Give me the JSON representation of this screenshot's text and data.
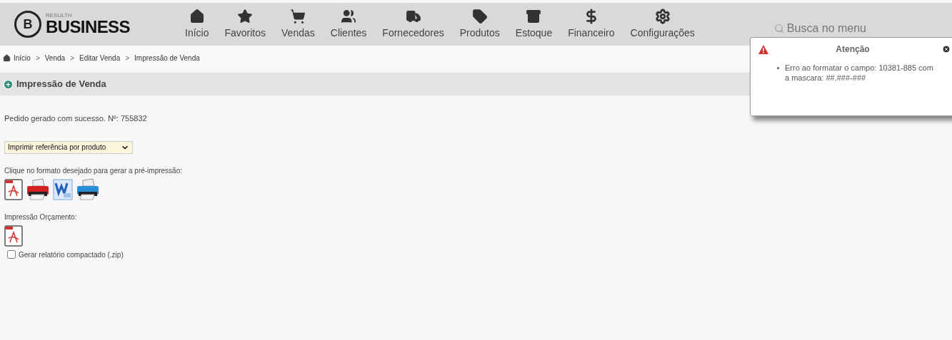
{
  "logo": {
    "mark": "B",
    "small": "RESULTH",
    "name": "BUSINESS"
  },
  "nav": [
    {
      "label": "Início",
      "kind": "home"
    },
    {
      "label": "Favoritos",
      "kind": "star"
    },
    {
      "label": "Vendas",
      "kind": "cart"
    },
    {
      "label": "Clientes",
      "kind": "users"
    },
    {
      "label": "Fornecedores",
      "kind": "truck"
    },
    {
      "label": "Produtos",
      "kind": "tag"
    },
    {
      "label": "Estoque",
      "kind": "box"
    },
    {
      "label": "Financeiro",
      "kind": "dollar"
    },
    {
      "label": "Configurações",
      "kind": "gear"
    }
  ],
  "search": {
    "placeholder": "Busca no menu"
  },
  "breadcrumb": [
    "Início",
    "Venda",
    "Editar Venda",
    "Impressão de Venda"
  ],
  "breadcrumb_separator": ">",
  "page_title": "Impressão de Venda",
  "message": "Pedido gerado com sucesso. Nº: 755832",
  "print_select": {
    "value": "Imprimir referência por produto"
  },
  "format_label": "Clique no formato desejado para gerar a pré-impressão:",
  "formats": [
    {
      "kind": "pdf"
    },
    {
      "kind": "printer-red"
    },
    {
      "kind": "word"
    },
    {
      "kind": "printer-blue"
    }
  ],
  "budget_label": "Impressão Orçamento:",
  "budget_formats": [
    {
      "kind": "pdf"
    }
  ],
  "zip_option": {
    "label": "Gerar relatório compactado (.zip)",
    "checked": false
  },
  "alert": {
    "title": "Atenção",
    "items": [
      "Erro ao formatar o campo: 10381-885 com a mascara: ##.###-###"
    ]
  }
}
